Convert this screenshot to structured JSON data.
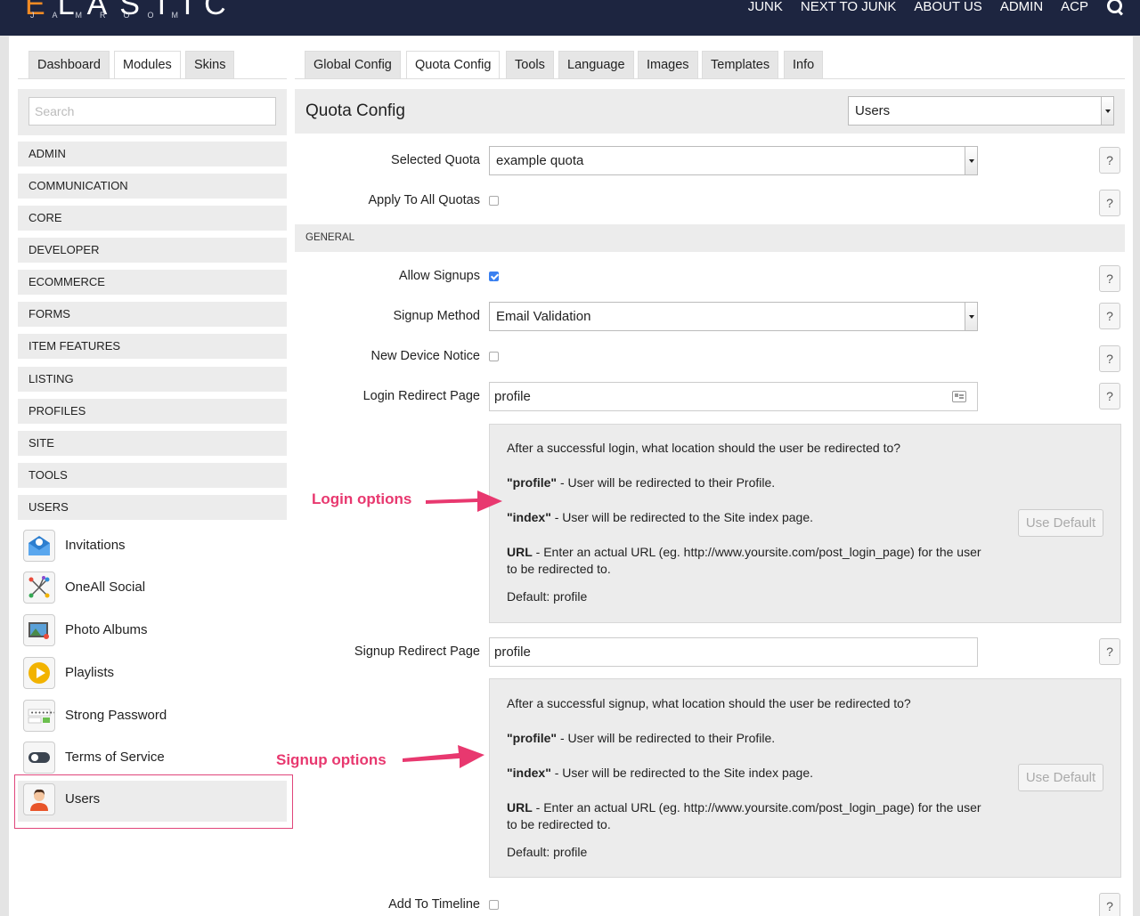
{
  "brand": {
    "logo_first": "E",
    "logo_rest": "LASTIC",
    "logo_sub": "JAMROOM"
  },
  "top_nav": [
    "JUNK",
    "NEXT TO JUNK",
    "ABOUT US",
    "ADMIN",
    "ACP"
  ],
  "left_tabs": [
    "Dashboard",
    "Modules",
    "Skins"
  ],
  "left_tabs_active": "Modules",
  "main_tabs": [
    "Global Config",
    "Quota Config",
    "Tools",
    "Language",
    "Images",
    "Templates",
    "Info"
  ],
  "main_tabs_active": "Quota Config",
  "sidebar": {
    "search_placeholder": "Search",
    "categories": [
      "ADMIN",
      "COMMUNICATION",
      "CORE",
      "DEVELOPER",
      "ECOMMERCE",
      "FORMS",
      "ITEM FEATURES",
      "LISTING",
      "PROFILES",
      "SITE",
      "TOOLS",
      "USERS"
    ],
    "modules": [
      {
        "label": "Invitations",
        "icon": "envelope-icon"
      },
      {
        "label": "OneAll Social",
        "icon": "social-network-icon"
      },
      {
        "label": "Photo Albums",
        "icon": "photo-icon"
      },
      {
        "label": "Playlists",
        "icon": "play-icon"
      },
      {
        "label": "Strong Password",
        "icon": "password-icon"
      },
      {
        "label": "Terms of Service",
        "icon": "toggle-icon"
      },
      {
        "label": "Users",
        "icon": "user-icon"
      }
    ],
    "active_module": "Users"
  },
  "header": {
    "title": "Quota Config",
    "selected_module": "Users"
  },
  "form": {
    "selected_quota_label": "Selected Quota",
    "selected_quota_value": "example quota",
    "apply_all_label": "Apply To All Quotas",
    "section_general": "GENERAL",
    "allow_signups_label": "Allow Signups",
    "allow_signups_checked": true,
    "signup_method_label": "Signup Method",
    "signup_method_value": "Email Validation",
    "new_device_label": "New Device Notice",
    "login_redirect_label": "Login Redirect Page",
    "login_redirect_value": "profile",
    "signup_redirect_label": "Signup Redirect Page",
    "signup_redirect_value": "profile",
    "add_timeline_label": "Add To Timeline",
    "help_label": "?",
    "use_default_label": "Use Default"
  },
  "login_help": {
    "intro": "After a successful login, what location should the user be redirected to?",
    "profile_key": "\"profile\"",
    "profile_text": " - User will be redirected to their Profile.",
    "index_key": "\"index\"",
    "index_text": " - User will be redirected to the Site index page.",
    "url_key": "URL",
    "url_text": " - Enter an actual URL (eg. http://www.yoursite.com/post_login_page) for the user to be redirected to.",
    "default_text": "Default: profile"
  },
  "signup_help": {
    "intro": "After a successful signup, what location should the user be redirected to?",
    "profile_key": "\"profile\"",
    "profile_text": " - User will be redirected to their Profile.",
    "index_key": "\"index\"",
    "index_text": " - User will be redirected to the Site index page.",
    "url_key": "URL",
    "url_text": " - Enter an actual URL (eg. http://www.yoursite.com/post_login_page) for the user to be redirected to.",
    "default_text": "Default: profile"
  },
  "annotations": {
    "login": "Login options",
    "signup": "Signup options"
  },
  "colors": {
    "topbar": "#1d2540",
    "accent_orange": "#f08a24",
    "annotation_pink": "#e8386f",
    "checkbox_blue": "#3a80f0"
  }
}
